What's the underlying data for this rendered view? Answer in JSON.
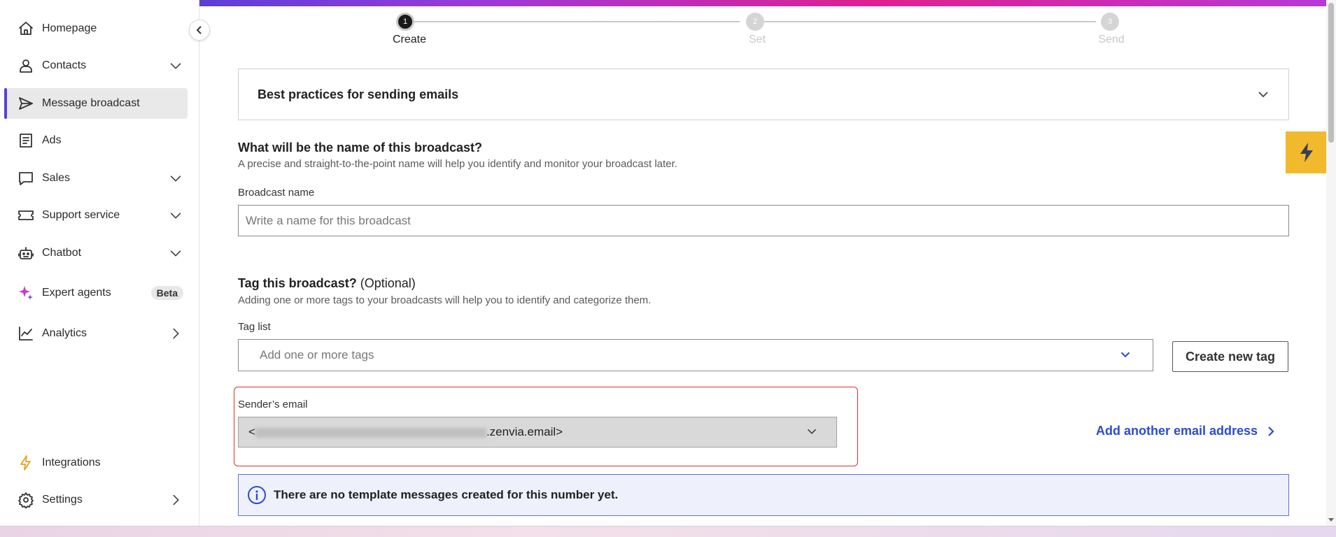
{
  "sidebar": {
    "items": [
      {
        "label": "Homepage",
        "icon": "home-icon"
      },
      {
        "label": "Contacts",
        "icon": "user-icon"
      },
      {
        "label": "Message broadcast",
        "icon": "send-icon"
      },
      {
        "label": "Ads",
        "icon": "newspaper-icon"
      },
      {
        "label": "Sales",
        "icon": "chat-icon"
      },
      {
        "label": "Support service",
        "icon": "ticket-icon"
      },
      {
        "label": "Chatbot",
        "icon": "robot-icon"
      },
      {
        "label": "Expert agents",
        "icon": "sparkle-icon",
        "badge": "Beta"
      },
      {
        "label": "Analytics",
        "icon": "chart-line-icon"
      },
      {
        "label": "Integrations",
        "icon": "lightning-icon"
      },
      {
        "label": "Settings",
        "icon": "gear-icon"
      }
    ]
  },
  "stepper": {
    "steps": [
      {
        "number": "1",
        "label": "Create",
        "active": true
      },
      {
        "number": "2",
        "label": "Set",
        "active": false
      },
      {
        "number": "3",
        "label": "Send",
        "active": false
      }
    ]
  },
  "accordion": {
    "title": "Best practices for sending emails"
  },
  "broadcast_name": {
    "title": "What will be the name of this broadcast?",
    "description": "A precise and straight-to-the-point name will help you identify and monitor your broadcast later.",
    "label": "Broadcast name",
    "placeholder": "Write a name for this broadcast"
  },
  "tags": {
    "title": "Tag this broadcast?",
    "optional": "(Optional)",
    "description": "Adding one or more tags to your broadcasts will help you to identify and categorize them.",
    "label": "Tag list",
    "placeholder": "Add one or more tags",
    "create_button": "Create new tag"
  },
  "sender": {
    "label": "Sender’s email",
    "value_prefix": "<",
    "value_suffix": ".zenvia.email>",
    "add_link": "Add another email address"
  },
  "banner": {
    "text": "There are no template messages created for this number yet."
  },
  "colors": {
    "accent": "#5b3fd6",
    "link": "#2b4ad8",
    "highlight": "#d93030",
    "flash": "#f2b92d"
  }
}
